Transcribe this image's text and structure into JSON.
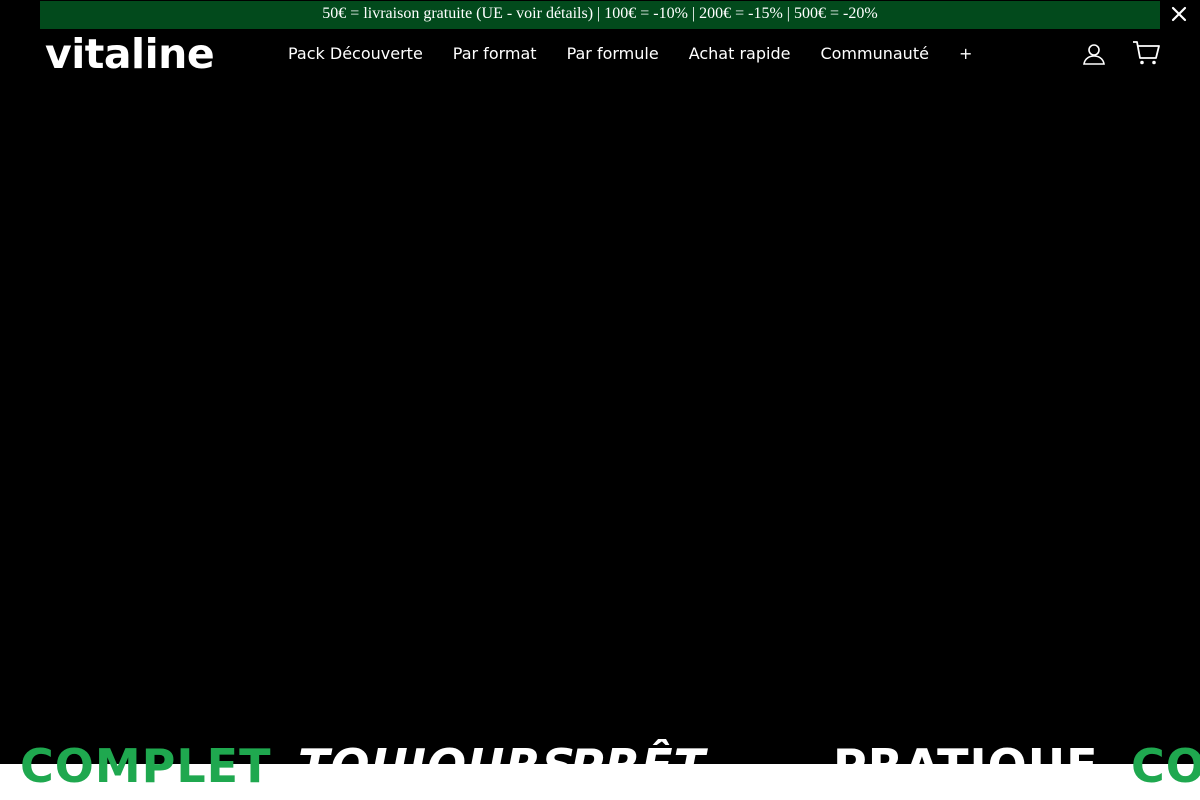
{
  "announcement": {
    "text": "50€ = livraison gratuite (UE - voir détails) | 100€ = -10% | 200€ = -15% | 500€ = -20%",
    "close_icon": "close-icon",
    "bar_color": "#024a1c"
  },
  "header": {
    "logo": "vitaline",
    "nav": [
      {
        "label": "Pack Découverte"
      },
      {
        "label": "Par format"
      },
      {
        "label": "Par formule"
      },
      {
        "label": "Achat rapide"
      },
      {
        "label": "Communauté"
      },
      {
        "label": "+"
      }
    ],
    "account_icon": "user-icon",
    "cart_icon": "cart-icon"
  },
  "hero": {
    "background": "#000000",
    "marquee": [
      {
        "text": "COMPLET",
        "color": "#1fa84f",
        "style": "normal"
      },
      {
        "text": "TOUJOURS",
        "color": "#ffffff",
        "style": "italic"
      },
      {
        "text": "PRÊT.",
        "color": "#ffffff",
        "style": "italic"
      },
      {
        "text": "PRATIQUE",
        "color": "#ffffff",
        "style": "normal"
      },
      {
        "text": "COMPLET",
        "color": "#1fa84f",
        "style": "normal"
      }
    ]
  }
}
